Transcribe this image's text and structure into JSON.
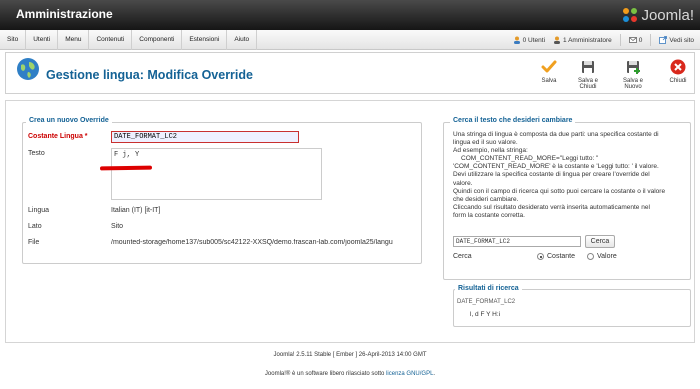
{
  "app": {
    "title": "Amministrazione",
    "logo_text": "Joomla!"
  },
  "menu": {
    "items": [
      "Sito",
      "Utenti",
      "Menu",
      "Contenuti",
      "Componenti",
      "Estensioni",
      "Aiuto"
    ]
  },
  "status": {
    "users": "0 Utenti",
    "admins": "1 Amministratore",
    "messages": "0",
    "view_site": "Vedi sito"
  },
  "page": {
    "title": "Gestione lingua: Modifica Override"
  },
  "toolbar": {
    "save": "Salva",
    "save_close": "Salva e Chiudi",
    "save_new": "Salva e Nuovo",
    "close": "Chiudi"
  },
  "form": {
    "legend": "Crea un nuovo Override",
    "constant_label": "Costante Lingua",
    "required_mark": "*",
    "constant_value": "DATE_FORMAT_LC2",
    "text_label": "Testo",
    "text_value": "F j, Y",
    "language_label": "Lingua",
    "language_value": "Italian (IT) [it-IT]",
    "side_label": "Lato",
    "side_value": "Sito",
    "file_label": "File",
    "file_value": "/mounted-storage/home137/sub005/sc42122-XXSQ/demo.frascan-lab.com/joomla25/langu"
  },
  "search": {
    "legend": "Cerca il testo che desideri cambiare",
    "help_lines": [
      "Una stringa di lingua è composta da due parti: una specifica costante di",
      "lingua ed il suo valore.",
      "Ad esempio, nella stringa:",
      "COM_CONTENT_READ_MORE=\"Leggi tutto: \"",
      "'COM_CONTENT_READ_MORE' è la costante e 'Leggi tutto: ' il valore.",
      "Devi utilizzare la specifica costante di lingua per creare l'override del",
      "valore.",
      "Quindi con il campo di ricerca qui sotto puoi cercare la costante o il valore",
      "che desideri cambiare.",
      "Cliccando sul risultato desiderato verrà inserita automaticamente nel",
      "form la costante corretta."
    ],
    "input_value": "DATE_FORMAT_LC2",
    "button": "Cerca",
    "type_label": "Cerca",
    "opt_constant": "Costante",
    "opt_value": "Valore",
    "results_legend": "Risultati di ricerca",
    "result_key": "DATE_FORMAT_LC2",
    "result_value": "l, d F Y H:i"
  },
  "footer": {
    "version": "Joomla! 2.5.11 Stable [ Ember ] 26-April-2013 14:00 GMT",
    "license_prefix": "Joomla!® è un software libero rilasciato sotto",
    "license_link": "licenza GNU/GPL",
    "license_suffix": "."
  }
}
